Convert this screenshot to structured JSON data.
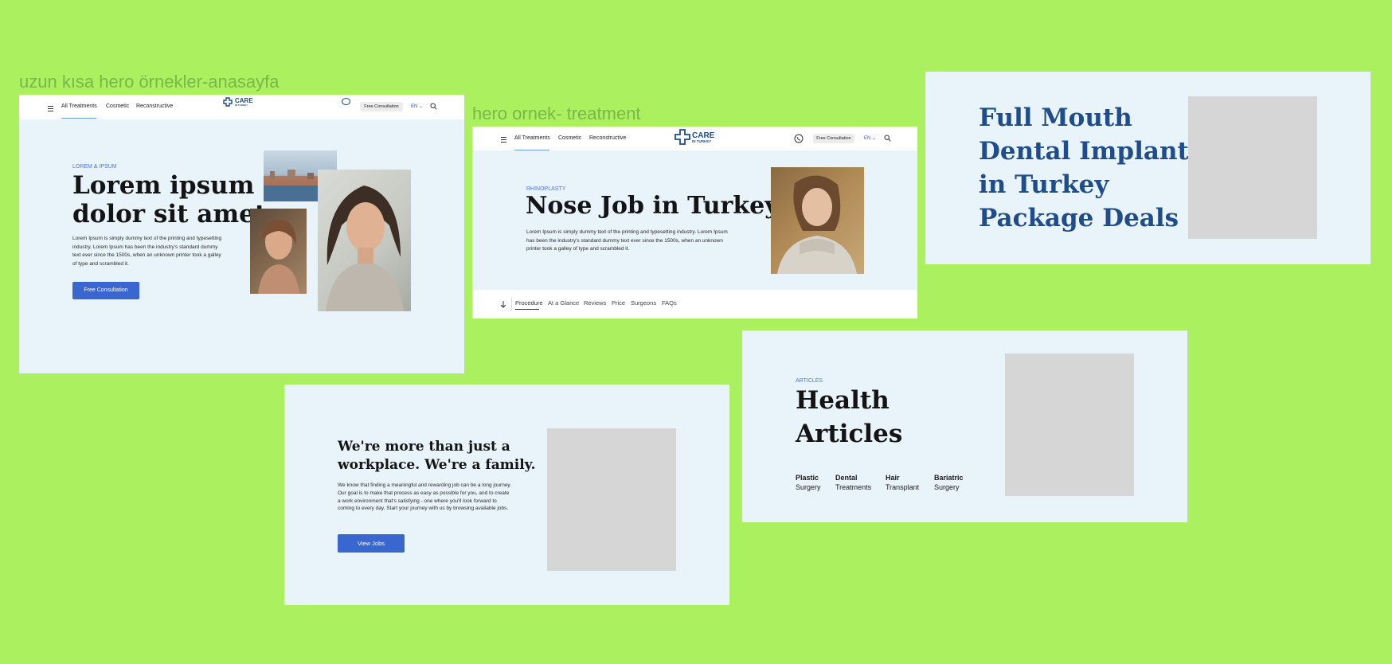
{
  "labels": {
    "frame1": "uzun kısa hero örnekler-anasayfa",
    "frame2": "hero ornek- treatment"
  },
  "nav": {
    "items": [
      "All Treatments",
      "Cosmetic",
      "Reconstructive"
    ],
    "cta": "Free Consultation",
    "lang": "EN",
    "logo_main": "CARE",
    "logo_sub": "IN TURKEY"
  },
  "hero_home": {
    "eyebrow": "LOREM & IPSUM",
    "title_line1": "Lorem ipsum",
    "title_line2": "dolor sit amet",
    "body": "Lorem Ipsum is simply dummy text of the printing and typesetting industry. Lorem Ipsum has been the industry's standard dummy text ever since the 1500s, when an unknown printer took a galley of type and scrambled it.",
    "button": "Free Consultation"
  },
  "hero_treatment": {
    "eyebrow": "RHINOPLASTY",
    "title": "Nose Job in Turkey",
    "body": "Lorem Ipsum is simply dummy text of the printing and typesetting industry. Lorem Ipsum has been the industry's standard dummy text ever since the 1500s, when an unknown printer took a galley of type and scrambled it.",
    "tabs": [
      "Procedure",
      "At a Glance",
      "Reviews",
      "Price",
      "Surgeons",
      "FAQs"
    ]
  },
  "dental": {
    "line1": "Full Mouth",
    "line2": "Dental Implants",
    "line3": "in Turkey",
    "line4": "Package Deals"
  },
  "careers": {
    "title_line1": "We're more than just a",
    "title_line2": "workplace. We're a family.",
    "body": "We know that finding a meaningful and rewarding job can be a long journey. Our goal is to make that process as easy as possible for you, and to create a work environment that's satisfying - one where you'll look forward to coming to every day. Start your journey with us by browsing available jobs.",
    "button": "View Jobs"
  },
  "articles": {
    "eyebrow": "ARTICLES",
    "title_line1": "Health",
    "title_line2": "Articles",
    "categories": [
      {
        "top": "Plastic",
        "bottom": "Surgery"
      },
      {
        "top": "Dental",
        "bottom": "Treatments"
      },
      {
        "top": "Hair",
        "bottom": "Transplant"
      },
      {
        "top": "Bariatric",
        "bottom": "Surgery"
      }
    ]
  },
  "colors": {
    "canvas": "#abf05e",
    "hero_bg": "#e8f3fa",
    "accent": "#3a66cf",
    "navy": "#1f4c8a"
  }
}
